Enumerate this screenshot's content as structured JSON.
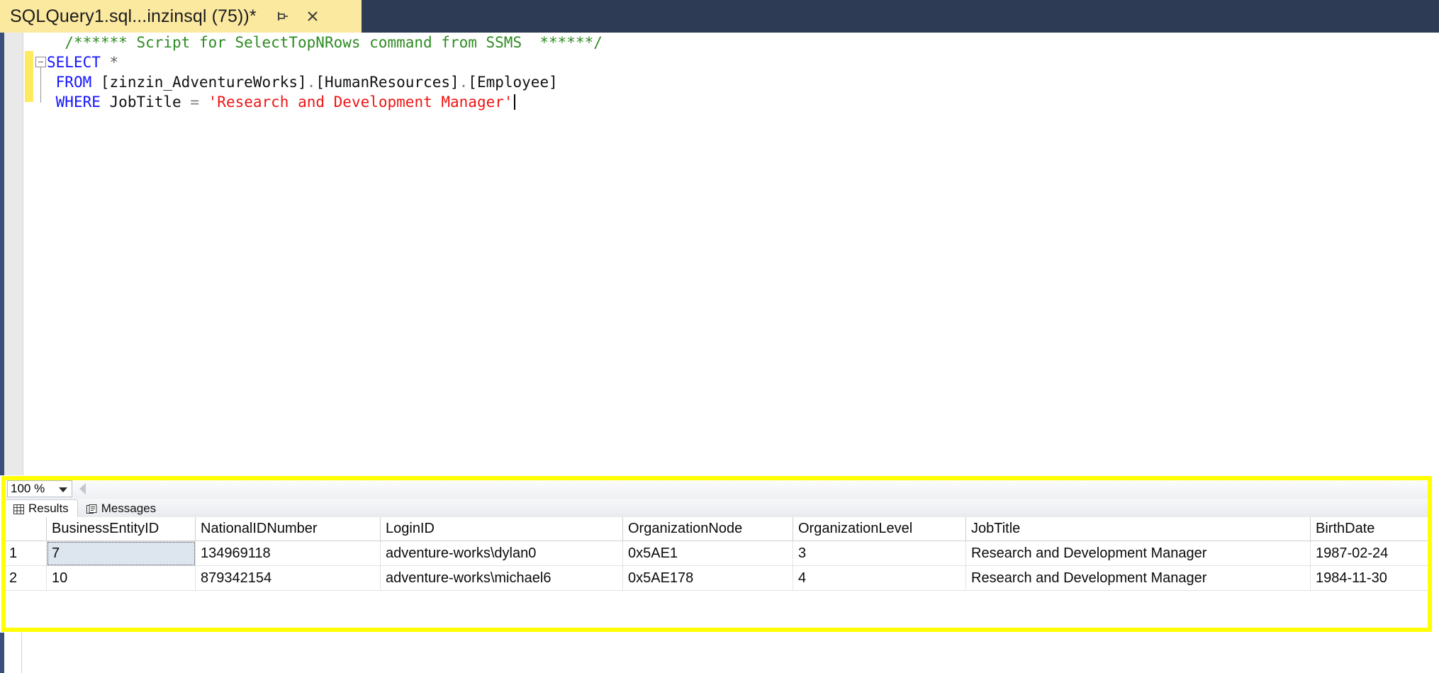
{
  "window": {
    "tab": {
      "title": "SQLQuery1.sql...inzinsql (75))*",
      "pin_icon": "pin-icon",
      "close_icon": "close-icon"
    }
  },
  "editor": {
    "language": "sql",
    "lines": [
      {
        "n": 1,
        "tokens": [
          {
            "t": "  ",
            "k": "plain"
          },
          {
            "t": "/****** Script for SelectTopNRows command from SSMS  ******/",
            "k": "cmt"
          }
        ]
      },
      {
        "n": 2,
        "tokens": [
          {
            "t": "SELECT",
            "k": "kw"
          },
          {
            "t": " ",
            "k": "plain"
          },
          {
            "t": "*",
            "k": "star"
          }
        ]
      },
      {
        "n": 3,
        "tokens": [
          {
            "t": " ",
            "k": "plain"
          },
          {
            "t": "FROM",
            "k": "kw"
          },
          {
            "t": " ",
            "k": "plain"
          },
          {
            "t": "[zinzin_AdventureWorks]",
            "k": "brk"
          },
          {
            "t": ".",
            "k": "dot"
          },
          {
            "t": "[HumanResources]",
            "k": "brk"
          },
          {
            "t": ".",
            "k": "dot"
          },
          {
            "t": "[Employee]",
            "k": "brk"
          }
        ]
      },
      {
        "n": 4,
        "tokens": [
          {
            "t": " ",
            "k": "plain"
          },
          {
            "t": "WHERE",
            "k": "kw"
          },
          {
            "t": " ",
            "k": "plain"
          },
          {
            "t": "JobTitle",
            "k": "id"
          },
          {
            "t": " ",
            "k": "plain"
          },
          {
            "t": "=",
            "k": "op"
          },
          {
            "t": " ",
            "k": "plain"
          },
          {
            "t": "'Research and Development Manager'",
            "k": "str"
          }
        ],
        "caret": true
      }
    ]
  },
  "results": {
    "toolbar": {
      "zoom_value": "100 %",
      "zoom_options": [
        "100 %"
      ],
      "dropdown_icon": "chevron-down-icon",
      "splitter_icon": "collapse-left-icon"
    },
    "tabs": [
      {
        "label": "Results",
        "icon": "grid-icon",
        "active": true
      },
      {
        "label": "Messages",
        "icon": "messages-icon",
        "active": false
      }
    ],
    "grid": {
      "columns": [
        "",
        "BusinessEntityID",
        "NationalIDNumber",
        "LoginID",
        "OrganizationNode",
        "OrganizationLevel",
        "JobTitle",
        "BirthDate"
      ],
      "rows": [
        {
          "num": "1",
          "cells": [
            "7",
            "134969118",
            "adventure-works\\dylan0",
            "0x5AE1",
            "3",
            "Research and Development Manager",
            "1987-02-24"
          ],
          "selected_cell_index": 0
        },
        {
          "num": "2",
          "cells": [
            "10",
            "879342154",
            "adventure-works\\michael6",
            "0x5AE178",
            "4",
            "Research and Development Manager",
            "1984-11-30"
          ],
          "selected_cell_index": -1
        }
      ]
    }
  },
  "colors": {
    "tab_background": "#fbe9a0",
    "titlebar": "#2d3b55",
    "annotation_highlight": "#ffff00",
    "keyword": "#1414ff",
    "comment": "#2e8b22",
    "string": "#f01414",
    "change_bar": "#ffe95e",
    "selected_cell": "#dde5ee"
  }
}
